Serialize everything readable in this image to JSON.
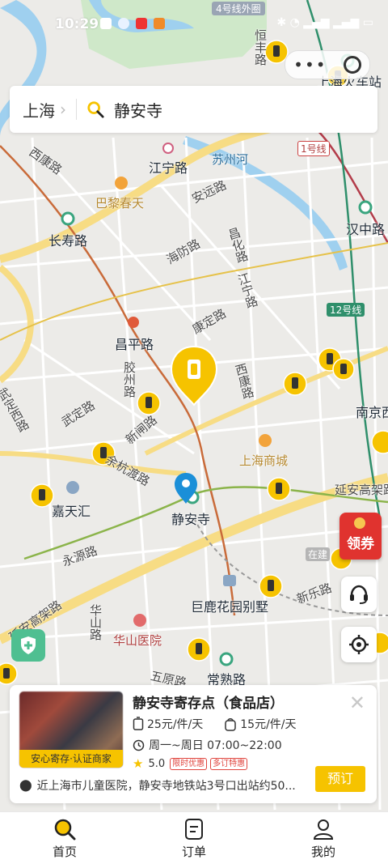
{
  "status_bar": {
    "time": "10:29"
  },
  "search": {
    "city": "上海",
    "keyword": "静安寺"
  },
  "map": {
    "labels": {
      "ring_road": "4号线外圈",
      "hengfeng": "恒丰路",
      "railway_station": "上海火车站",
      "xikang_n": "西康路",
      "jiangning": "江宁路",
      "suzhou_river": "苏州河",
      "line1": "1号线",
      "anyuan": "安远路",
      "bali": "巴黎春天",
      "hanzhong": "汉中路",
      "changshou": "长寿路",
      "haifang": "海防路",
      "changhua": "昌化路",
      "jiangning_s": "江宁路",
      "line12": "12号线",
      "changping": "昌平路",
      "kangding": "康定路",
      "jiaozhou": "胶州路",
      "xikang_s": "西康路",
      "wuding_w": "武定西路",
      "wuding": "武定路",
      "xinzha": "新闸路",
      "nanjing_w": "南京西",
      "yuhangdu": "余杭渡路",
      "shanghai_mall": "上海商城",
      "yanan": "延安高架路",
      "jiadehui": "嘉天汇",
      "jingan_temple": "静安寺",
      "yongyuan": "永源路",
      "zaijian": "在建",
      "julu_garden": "巨鹿花园别墅",
      "xinle": "新乐路",
      "yanan_elev": "延安高架路",
      "huashan_road": "华山路",
      "huashan_hospital": "华山医院",
      "wuyuan": "五原路",
      "changshu": "常熟路"
    }
  },
  "coupon": {
    "label": "领券"
  },
  "store": {
    "name": "静安寺寄存点（食品店）",
    "badge": "安心寄存·认证商家",
    "price_large": "25元/件/天",
    "price_small": "15元/件/天",
    "hours": "周一~周日 07:00~22:00",
    "rating": "5.0",
    "tags": [
      "限时优惠",
      "多订特惠"
    ],
    "address": "近上海市儿童医院，静安寺地铁站3号口出站约50...",
    "book_label": "预订"
  },
  "tabs": [
    {
      "label": "首页",
      "icon": "search-icon"
    },
    {
      "label": "订单",
      "icon": "order-icon"
    },
    {
      "label": "我的",
      "icon": "profile-icon"
    }
  ],
  "colors": {
    "accent": "#f6c300",
    "pin_blue": "#1b8fd8",
    "coupon_red": "#e0332f",
    "shield_green": "#4fbf91"
  }
}
